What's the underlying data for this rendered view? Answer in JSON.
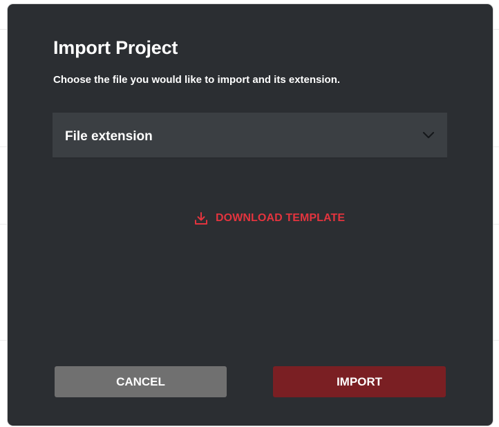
{
  "dialog": {
    "title": "Import Project",
    "subtitle": "Choose the file you would like to import and its extension.",
    "file_extension_select": {
      "label": "File extension",
      "icon": "chevron-down-icon"
    },
    "download_template": {
      "label": "DOWNLOAD TEMPLATE",
      "icon": "download-icon",
      "color": "#e3343e"
    },
    "buttons": {
      "cancel_label": "CANCEL",
      "import_label": "IMPORT"
    }
  },
  "colors": {
    "dialog_background": "#2b2e32",
    "select_background": "#3b3f43",
    "cancel_button": "#707070",
    "import_button": "#7a1f23",
    "accent": "#e3343e"
  }
}
